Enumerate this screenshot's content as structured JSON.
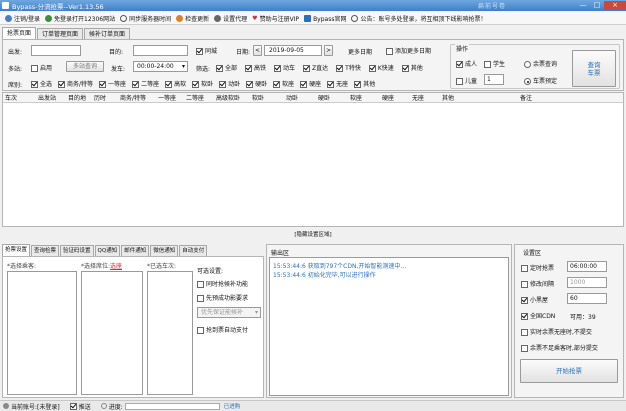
{
  "app": {
    "title": "Bypass-分流抢票--Ver1.13.56",
    "blurred_title": "扁前号卷",
    "win_min": "—",
    "win_max": "□",
    "win_close": "×"
  },
  "toolbar": [
    {
      "label": "注销/登录",
      "icon": "user-icon",
      "color": "#4a7fc1"
    },
    {
      "label": "免登录打开12306网站",
      "icon": "globe-icon",
      "color": "#3c8f3c"
    },
    {
      "label": "同步服务器时间",
      "icon": "clock-icon",
      "color": "#555555"
    },
    {
      "label": "检查更新",
      "icon": "update-icon",
      "color": "#d9822b"
    },
    {
      "label": "设置代理",
      "icon": "gear-icon",
      "color": "#666666"
    },
    {
      "label": "赞助与注册VIP",
      "icon": "heart-icon",
      "color": "#c8323c"
    },
    {
      "label": "Bypass官网",
      "icon": "home-icon",
      "color": "#2d6fb8"
    },
    {
      "label": "公告：账号多处登录，将互相顶下线影响抢票！",
      "icon": "notice-icon",
      "color": "#555555"
    }
  ],
  "tabs": [
    "抢票页面",
    "订单管理页面",
    "候补订单页面"
  ],
  "form": {
    "depart_label": "出发:",
    "dest_label": "目的:",
    "tongcheng_label": "同城",
    "date_label": "日期:",
    "date_value": "2019-09-05",
    "more_dates_label": "更多日期",
    "add_more_dates_label": "添加更多日期",
    "multistation_label": "多站:",
    "enable_label": "启用",
    "multistation_btn": "多站查询",
    "time_label": "发车:",
    "time_value": "00:00-24:00",
    "filter_label": "筛选:",
    "filters": [
      "全部",
      "高铁",
      "动车",
      "Z直达",
      "T特快",
      "K快速",
      "其他"
    ],
    "seat_label": "席别:",
    "seats": [
      "全选",
      "商务/特等",
      "一等座",
      "二等座",
      "高软",
      "软卧",
      "动卧",
      "硬卧",
      "软座",
      "硬座",
      "无座",
      "其他"
    ]
  },
  "ops": {
    "title": "操作",
    "adult_label": "成人",
    "student_label": "学生",
    "child_label": "儿童",
    "child_count": "1",
    "left_query_label": "余票查询",
    "booking_label": "车票预定",
    "query_btn": "查询\n车票"
  },
  "table_headers": [
    "车次",
    "出发站",
    "目的地",
    "历时",
    "商务/特等",
    "一等座",
    "二等座",
    "高级软卧",
    "软卧",
    "动卧",
    "硬卧",
    "软座",
    "硬座",
    "无座",
    "其他",
    "备注"
  ],
  "hide_toggle": "[隐藏设置区域]",
  "settings_tabs": [
    "抢票设置",
    "查询检票",
    "验证码设置",
    "QQ通知",
    "邮件通知",
    "微信通知",
    "自动支付"
  ],
  "passenger_label": "*选择乘客:",
  "seat_pick_label": "*选择席位:",
  "seat_pick_link": "选座",
  "train_pick_label": "*已选车次:",
  "optional": {
    "title": "可选设置:",
    "items": [
      "同时抢候补功能",
      "先预成功影要求",
      "抢到票自动支付"
    ],
    "select_value": "优先保证能候补"
  },
  "output": {
    "title": "输出区",
    "lines": [
      {
        "time": "15:53:44:6",
        "text": "获取到797个CDN,开始智能测速中..."
      },
      {
        "time": "15:53:44:6",
        "text": "初始化完毕,可以进行操作"
      }
    ]
  },
  "settings": {
    "title": "设置区",
    "scheduled_label": "定时抢票",
    "scheduled_value": "06:00:00",
    "interval_label": "修改间隔",
    "interval_value": "1000",
    "darkroom_label": "小黑屋",
    "darkroom_value": "60",
    "cdn_label": "全国CDN",
    "cdn_count": "可用：39",
    "realtime_label": "实时余票无座时,不提交",
    "partial_label": "余票不足乘客时,部分提交",
    "start_btn": "开始抢票"
  },
  "status": {
    "account": "当前账号:[未登录]",
    "push": "推送",
    "progress_label": "进度:",
    "bottom_text": "已进购"
  }
}
